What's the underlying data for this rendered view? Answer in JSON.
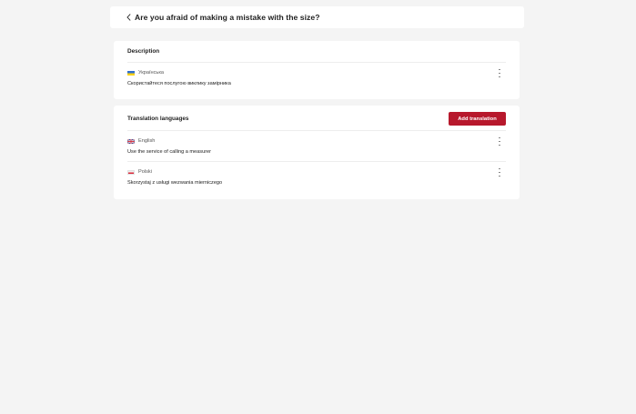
{
  "header": {
    "title": "Are you afraid of making a mistake with the size?"
  },
  "description": {
    "title": "Description",
    "language": "Українська",
    "text": "Скористайтеся послугою виклику замірника"
  },
  "translations": {
    "title": "Translation languages",
    "add_button_label": "Add translation",
    "items": [
      {
        "language": "English",
        "flag": "gb",
        "text": "Use the service of calling a measurer"
      },
      {
        "language": "Polski",
        "flag": "pl",
        "text": "Skorzystaj z usługi wezwania mierniczego"
      }
    ]
  },
  "colors": {
    "accent": "#b7182c",
    "background": "#f4f4f4",
    "card": "#ffffff"
  }
}
